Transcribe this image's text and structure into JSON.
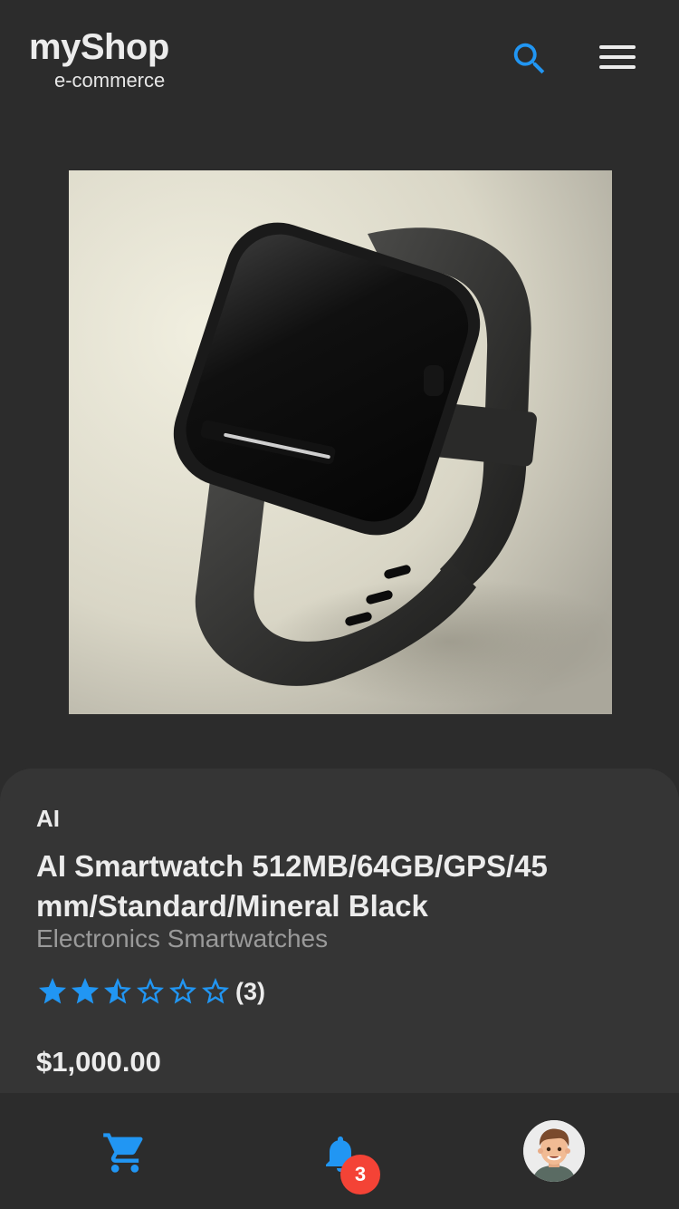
{
  "header": {
    "brand_name": "myShop",
    "brand_tag": "e-commerce",
    "search_icon": "search-icon",
    "menu_icon": "hamburger-menu-icon"
  },
  "product": {
    "image_icon": "smartwatch-image",
    "brand": "AI",
    "title": "AI Smartwatch 512MB/64GB/GPS/45 mm/Standard/Mineral Black",
    "category": "Electronics Smartwatches",
    "rating": {
      "value": 2.5,
      "max": 5,
      "count_label": "(3)"
    },
    "price": "$1,000.00"
  },
  "bottom_nav": {
    "cart_icon": "cart-icon",
    "bell_icon": "bell-icon",
    "notification_count": "3",
    "avatar_icon": "avatar"
  },
  "colors": {
    "background": "#2c2c2c",
    "card": "#353535",
    "accent": "#2196f3",
    "badge": "#f44336"
  }
}
